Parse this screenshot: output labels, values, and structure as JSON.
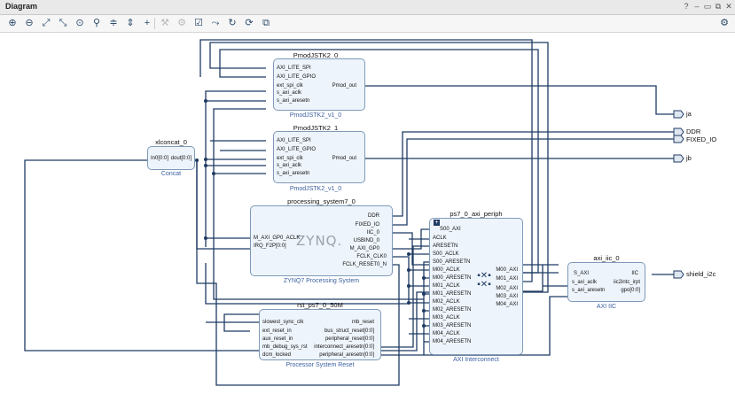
{
  "window": {
    "title": "Diagram",
    "help": "?",
    "minimize": "–",
    "restore": "▭",
    "float": "⧉",
    "close": "✕"
  },
  "toolbar": {
    "icons": [
      "zoom-in-icon",
      "zoom-out-icon",
      "zoom-fit-icon",
      "fit-selection-icon",
      "target-icon",
      "search-icon",
      "collapse-icon",
      "expand-icon",
      "add-ip-icon",
      "wrench-icon",
      "wrench2-icon",
      "validate-icon",
      "route-icon",
      "refresh-icon",
      "regenerate-icon",
      "layers-icon"
    ],
    "settings": "⚙"
  },
  "blocks": {
    "pmod0": {
      "name": "PmodJSTK2_0",
      "title": "PmodJSTK2_v1_0",
      "ports_left": [
        "AXI_LITE_SPI",
        "AXI_LITE_GPIO",
        "ext_spi_clk",
        "s_axi_aclk",
        "s_axi_aresetn"
      ],
      "ports_right": [
        "Pmod_out"
      ]
    },
    "pmod1": {
      "name": "PmodJSTK2_1",
      "title": "PmodJSTK2_v1_0",
      "ports_left": [
        "AXI_LITE_SPI",
        "AXI_LITE_GPIO",
        "ext_spi_clk",
        "s_axi_aclk",
        "s_axi_aresetn"
      ],
      "ports_right": [
        "Pmod_out"
      ]
    },
    "concat": {
      "name": "xlconcat_0",
      "title": "Concat",
      "ports_left": [
        "In0[0:0]"
      ],
      "ports_right": [
        "dout[0:0]"
      ]
    },
    "ps7": {
      "name": "processing_system7_0",
      "title": "ZYNQ7 Processing System",
      "logo": "ZYNQ.",
      "ports_left": [
        "M_AXI_GP0_ACLK",
        "IRQ_F2P[0:0]"
      ],
      "ports_right": [
        "DDR",
        "FIXED_IO",
        "IIC_0",
        "USBIND_0",
        "M_AXI_GP0",
        "FCLK_CLK0",
        "FCLK_RESET0_N"
      ]
    },
    "rst": {
      "name": "rst_ps7_0_50M",
      "title": "Processor System Reset",
      "ports_left": [
        "slowest_sync_clk",
        "ext_reset_in",
        "aux_reset_in",
        "mb_debug_sys_rst",
        "dcm_locked"
      ],
      "ports_right": [
        "mb_reset",
        "bus_struct_reset[0:0]",
        "peripheral_reset[0:0]",
        "interconnect_aresetn[0:0]",
        "peripheral_aresetn[0:0]"
      ]
    },
    "periph": {
      "name": "ps7_0_axi_periph",
      "title": "AXI Interconnect",
      "ports_left": [
        "S00_AXI",
        "ACLK",
        "ARESETN",
        "S00_ACLK",
        "S00_ARESETN",
        "M00_ACLK",
        "M00_ARESETN",
        "M01_ACLK",
        "M01_ARESETN",
        "M02_ACLK",
        "M02_ARESETN",
        "M03_ACLK",
        "M03_ARESETN",
        "M04_ACLK",
        "M04_ARESETN"
      ],
      "ports_right": [
        "M00_AXI",
        "M01_AXI",
        "M02_AXI",
        "M03_AXI",
        "M04_AXI"
      ]
    },
    "iic": {
      "name": "axi_iic_0",
      "title": "AXI IIC",
      "ports_left": [
        "S_AXI",
        "s_axi_aclk",
        "s_axi_aresetn"
      ],
      "ports_right": [
        "IIC",
        "iic2intc_irpt",
        "gpo[0:0]"
      ]
    }
  },
  "external_ports": [
    "ja",
    "DDR",
    "FIXED_IO",
    "jb",
    "shield_i2c"
  ]
}
